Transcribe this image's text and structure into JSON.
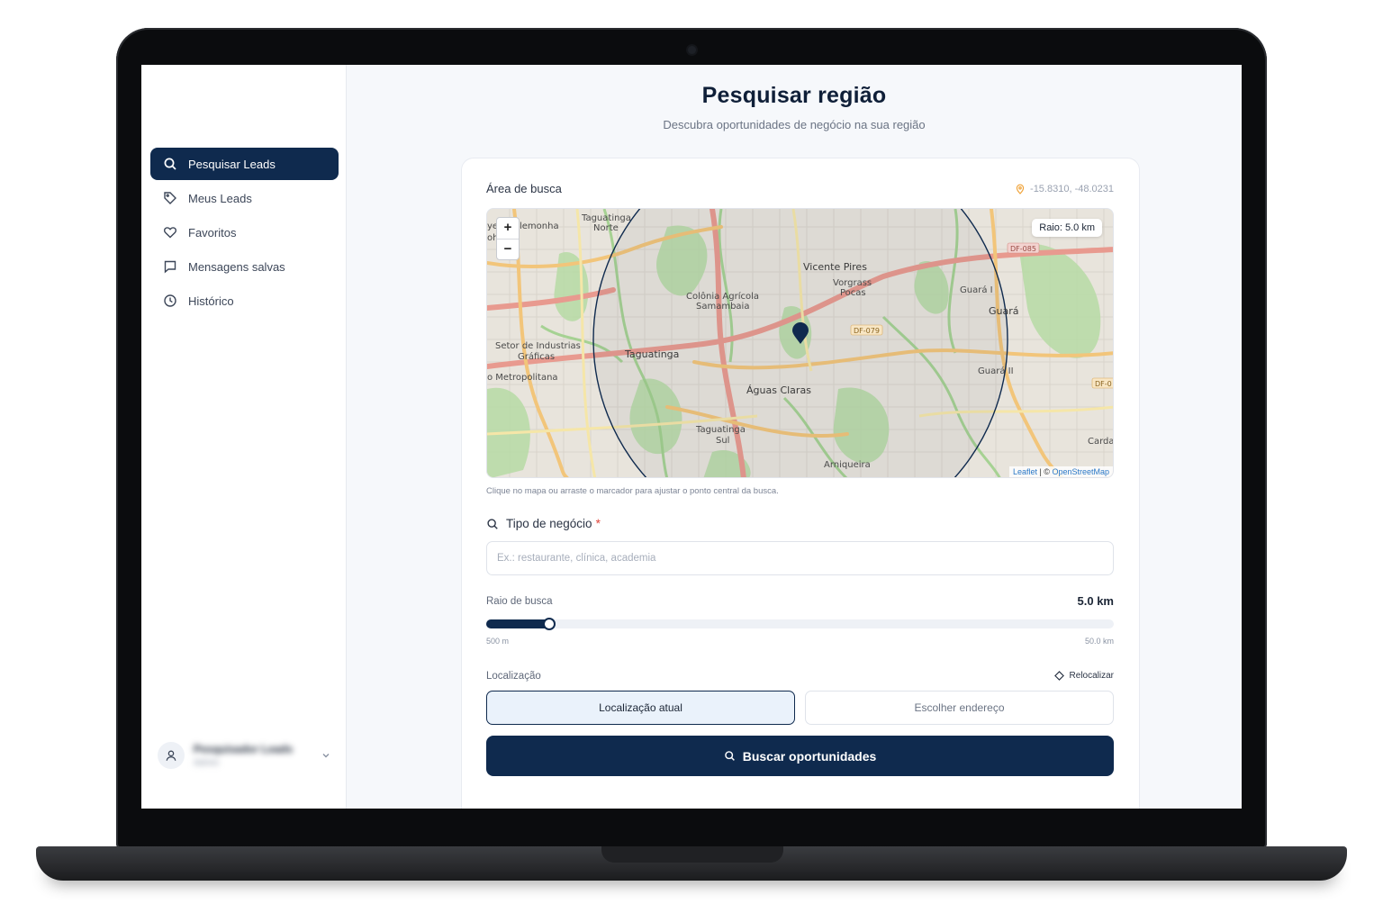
{
  "page": {
    "title": "Pesquisar região",
    "subtitle": "Descubra oportunidades de negócio na sua região"
  },
  "sidebar": {
    "items": [
      {
        "label": "Pesquisar Leads",
        "icon": "search-icon",
        "active": true
      },
      {
        "label": "Meus Leads",
        "icon": "tag-icon",
        "active": false
      },
      {
        "label": "Favoritos",
        "icon": "heart-icon",
        "active": false
      },
      {
        "label": "Mensagens salvas",
        "icon": "message-icon",
        "active": false
      },
      {
        "label": "Histórico",
        "icon": "clock-icon",
        "active": false
      }
    ],
    "user": {
      "name": "Pesquisador Leads",
      "role": "Admin"
    }
  },
  "search_area": {
    "title": "Área de busca",
    "coordinates": "-15.8310, -48.0231",
    "radius_badge": "Raio: 5.0 km",
    "zoom_in": "+",
    "zoom_out": "−",
    "attribution_leaflet": "Leaflet",
    "attribution_sep": " | © ",
    "attribution_osm": "OpenStreetMap",
    "help_text": "Clique no mapa ou arraste o marcador para ajustar o ponto central da busca.",
    "map_labels": {
      "taguatinga_norte_1": "Taguatinga",
      "taguatinga_norte_2": "Norte",
      "vicente_pires": "Vicente Pires",
      "vorgrass_1": "Vorgrass",
      "vorgrass_2": "Pocas",
      "colonia_1": "Colônia Agrícola",
      "colonia_2": "Samambaia",
      "setor_1": "Setor de Industrias",
      "setor_2": "Gráficas",
      "metropolitana": "o Metropolitana",
      "taguatinga": "Taguatinga",
      "aguas_claras": "Águas Claras",
      "taguatinga_sul_1": "Taguatinga",
      "taguatinga_sul_2": "Sul",
      "arniqueira": "Arniqueira",
      "guara_i": "Guará I",
      "guara": "Guará",
      "guara_ii": "Guará II",
      "carda": "Carda",
      "df085": "DF-085",
      "df079": "DF-079",
      "df0": "DF-0",
      "alemonha": "lemonha",
      "ye": "ye",
      "oh": "oh"
    }
  },
  "business_type": {
    "label": "Tipo de negócio",
    "required_mark": "*",
    "value": "",
    "placeholder": "Ex.: restaurante, clínica, academia"
  },
  "radius": {
    "label": "Raio de busca",
    "value_text": "5.0 km",
    "value_km": 5.0,
    "min_km": 0.5,
    "max_km": 50.0,
    "min_label": "500 m",
    "max_label": "50.0 km"
  },
  "location": {
    "label": "Localização",
    "relocate": "Relocalizar",
    "option_current": "Localização atual",
    "option_address": "Escolher endereço",
    "selected": "current"
  },
  "cta": {
    "label": "Buscar oportunidades"
  },
  "colors": {
    "primary": "#0f2a4e",
    "required": "#e0453b",
    "map_road": "#e07a7a",
    "map_green": "#a9d59a"
  }
}
